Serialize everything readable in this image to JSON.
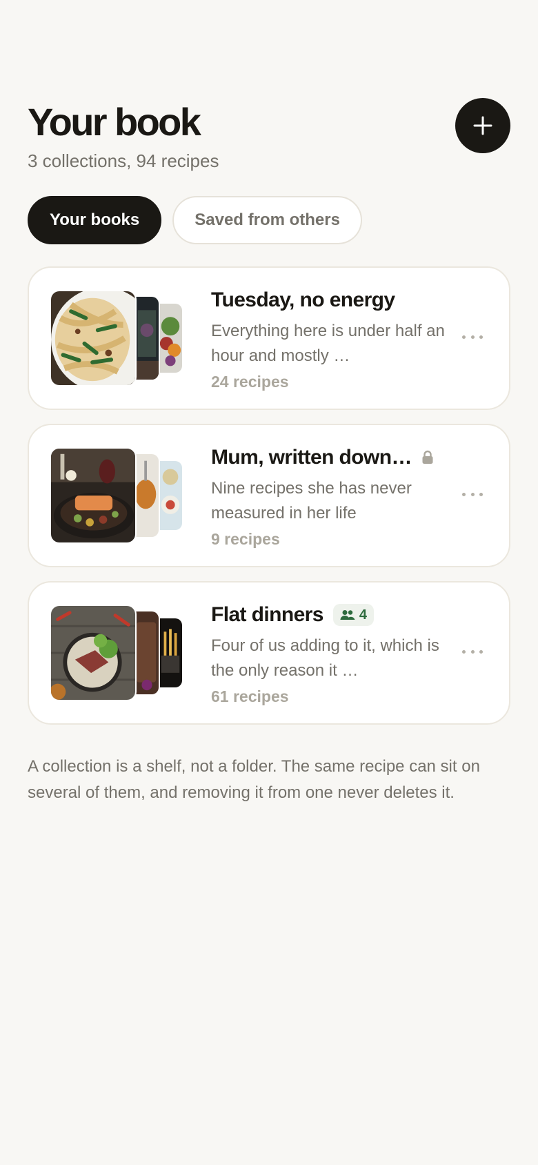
{
  "header": {
    "title": "Your book",
    "subtitle": "3 collections, 94 recipes",
    "add_icon": "plus-icon"
  },
  "tabs": [
    {
      "label": "Your books",
      "active": true
    },
    {
      "label": "Saved from others",
      "active": false
    }
  ],
  "collections": [
    {
      "name": "Tuesday, no energy",
      "description": "Everything here is under half an hour and mostly …",
      "count": "24 recipes",
      "badge": null
    },
    {
      "name": "Mum, written down…",
      "description": "Nine recipes she has never measured in her life",
      "count": "9 recipes",
      "badge": {
        "icon": "lock-icon"
      }
    },
    {
      "name": "Flat dinners",
      "description": "Four of us adding to it, which is the only reason it …",
      "count": "61 recipes",
      "badge": {
        "icon": "people-icon",
        "value": "4"
      }
    }
  ],
  "footer_note": "A collection is a shelf, not a folder. The same recipe can sit on several of them, and removing it from one never deletes it.",
  "colors": {
    "background": "#f8f7f4",
    "ink": "#1a1814",
    "muted": "#74716a",
    "faint": "#aaa69c",
    "border": "#ebe7de",
    "shared_green": "#2e6b3e"
  }
}
